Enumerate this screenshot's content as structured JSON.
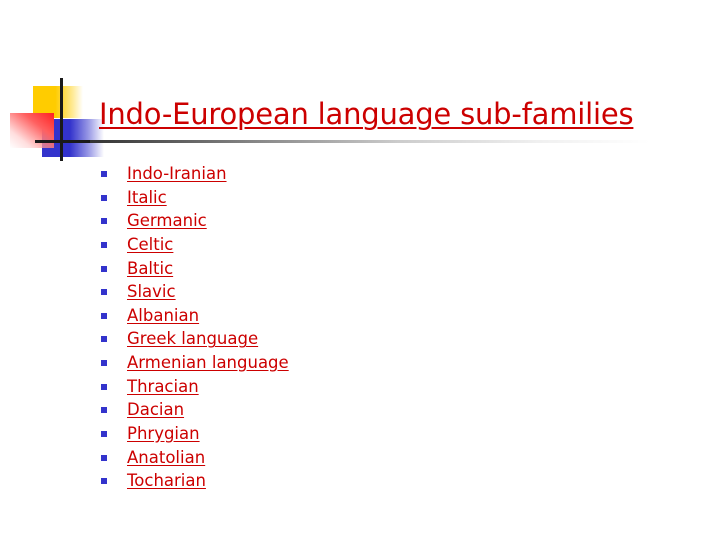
{
  "slide": {
    "title": "Indo-European language sub-families",
    "items": [
      {
        "label": "Indo-Iranian"
      },
      {
        "label": "Italic"
      },
      {
        "label": "Germanic"
      },
      {
        "label": "Celtic"
      },
      {
        "label": "Baltic"
      },
      {
        "label": "Slavic"
      },
      {
        "label": "Albanian"
      },
      {
        "label": "Greek language"
      },
      {
        "label": "Armenian language"
      },
      {
        "label": "Thracian"
      },
      {
        "label": "Dacian"
      },
      {
        "label": "Phrygian"
      },
      {
        "label": "Anatolian"
      },
      {
        "label": "Tocharian"
      }
    ],
    "bullet_icon": "square-bullet-icon"
  },
  "colors": {
    "title": "#cc0000",
    "link": "#cc0000",
    "bullet": "#3333cc",
    "deco_yellow": "#ffcc00",
    "deco_blue": "#3333cc",
    "deco_red": "#ff2020"
  }
}
